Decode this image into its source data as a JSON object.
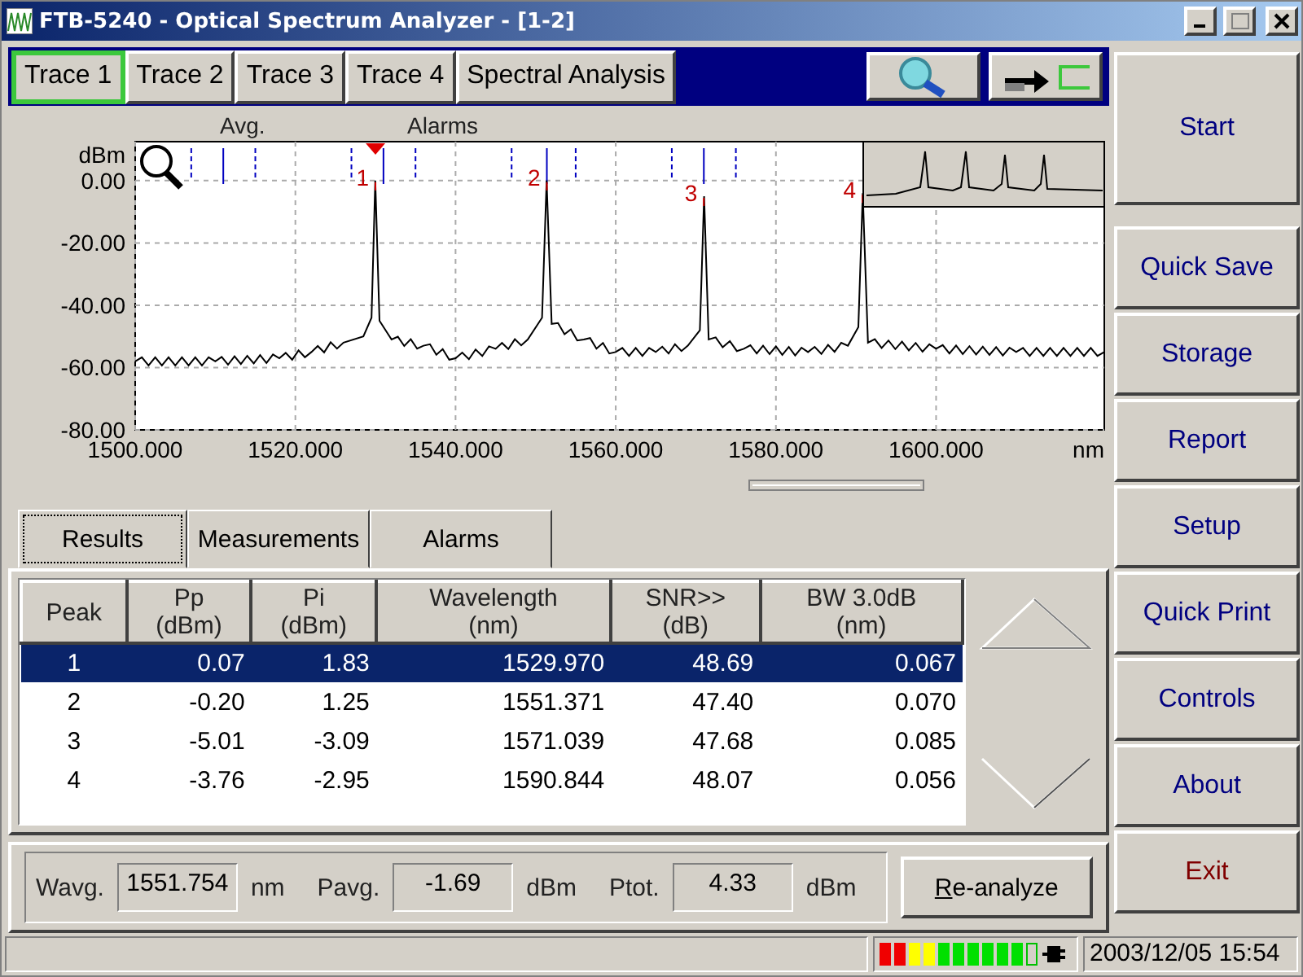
{
  "window": {
    "title": "FTB-5240 - Optical Spectrum Analyzer - [1-2]"
  },
  "trace_tabs": [
    {
      "label": "Trace 1",
      "selected": true
    },
    {
      "label": "Trace 2",
      "selected": false
    },
    {
      "label": "Trace 3",
      "selected": false
    },
    {
      "label": "Trace 4",
      "selected": false
    },
    {
      "label": "Spectral Analysis",
      "selected": false
    }
  ],
  "chart_header": {
    "left": "Avg.",
    "right": "Alarms"
  },
  "chart_data": {
    "type": "line",
    "xlabel": "nm",
    "ylabel": "dBm",
    "x": [
      1500,
      1510,
      1518,
      1522,
      1526,
      1528.5,
      1529.5,
      1529.97,
      1530.5,
      1532,
      1536,
      1540,
      1545,
      1549,
      1550.8,
      1551.371,
      1552,
      1556,
      1560,
      1565,
      1569,
      1570.5,
      1571.039,
      1571.6,
      1576,
      1584,
      1589,
      1590.3,
      1590.844,
      1591.5,
      1600,
      1610,
      1621
    ],
    "series": [
      {
        "color": "#000000",
        "values": [
          -58,
          -58,
          -57,
          -55,
          -52,
          -50,
          -44,
          0,
          -45,
          -51,
          -53,
          -57,
          -54,
          -51,
          -44,
          0,
          -46,
          -51,
          -55,
          -55,
          -53,
          -48,
          -5,
          -51,
          -54,
          -55,
          -53,
          -47,
          -4,
          -52,
          -54,
          -55,
          -55
        ]
      }
    ],
    "grid": true,
    "ref_lines": [
      {
        "axis": "x",
        "value": 1507
      },
      {
        "axis": "x",
        "value": 1511
      },
      {
        "axis": "x",
        "value": 1515
      },
      {
        "axis": "x",
        "value": 1527
      },
      {
        "axis": "x",
        "value": 1531
      },
      {
        "axis": "x",
        "value": 1535
      },
      {
        "axis": "x",
        "value": 1547
      },
      {
        "axis": "x",
        "value": 1551.4
      },
      {
        "axis": "x",
        "value": 1555
      },
      {
        "axis": "x",
        "value": 1567
      },
      {
        "axis": "x",
        "value": 1571
      },
      {
        "axis": "x",
        "value": 1575
      }
    ],
    "xlim": [
      1500,
      1621
    ],
    "ylim": [
      -80,
      12.5
    ],
    "xticks": [
      {
        "value": 1500,
        "label": "1500.000"
      },
      {
        "value": 1520,
        "label": "1520.000"
      },
      {
        "value": 1540,
        "label": "1540.000"
      },
      {
        "value": 1560,
        "label": "1560.000"
      },
      {
        "value": 1580,
        "label": "1580.000"
      },
      {
        "value": 1600,
        "label": "1600.000"
      }
    ],
    "yticks": [
      {
        "value": 0,
        "label": "0.00"
      },
      {
        "value": -20,
        "label": "-20.00"
      },
      {
        "value": -40,
        "label": "-40.00"
      },
      {
        "value": -60,
        "label": "-60.00"
      },
      {
        "value": -80,
        "label": "-80.00"
      }
    ],
    "annotations": [
      {
        "x": 1530,
        "y": 0,
        "text": "1"
      },
      {
        "x": 1551.4,
        "y": 0,
        "text": "2"
      },
      {
        "x": 1571,
        "y": -5,
        "text": "3"
      },
      {
        "x": 1590.8,
        "y": -4,
        "text": "4"
      }
    ]
  },
  "result_tabs": [
    {
      "label": "Results",
      "selected": true
    },
    {
      "label": "Measurements",
      "selected": false
    },
    {
      "label": "Alarms",
      "selected": false
    }
  ],
  "table": {
    "columns": [
      {
        "label": "Peak"
      },
      {
        "label": "Pp",
        "unit": "(dBm)"
      },
      {
        "label": "Pi",
        "unit": "(dBm)"
      },
      {
        "label": "Wavelength",
        "unit": "(nm)"
      },
      {
        "label": "SNR>>",
        "unit": "(dB)"
      },
      {
        "label": "BW 3.0dB",
        "unit": "(nm)"
      }
    ],
    "rows": [
      {
        "selected": true,
        "cells": [
          "1",
          "0.07",
          "1.83",
          "1529.970",
          "48.69",
          "0.067"
        ]
      },
      {
        "selected": false,
        "cells": [
          "2",
          "-0.20",
          "1.25",
          "1551.371",
          "47.40",
          "0.070"
        ]
      },
      {
        "selected": false,
        "cells": [
          "3",
          "-5.01",
          "-3.09",
          "1571.039",
          "47.68",
          "0.085"
        ]
      },
      {
        "selected": false,
        "cells": [
          "4",
          "-3.76",
          "-2.95",
          "1590.844",
          "48.07",
          "0.056"
        ]
      }
    ]
  },
  "summary": [
    {
      "label": "Wavg.",
      "value": "1551.754",
      "unit": "nm"
    },
    {
      "label": "Pavg.",
      "value": "-1.69",
      "unit": "dBm"
    },
    {
      "label": "Ptot.",
      "value": "4.33",
      "unit": "dBm"
    }
  ],
  "reanalyze_button": "Re-analyze",
  "side_buttons": [
    {
      "label": "Start",
      "color": "#000080"
    },
    {
      "label": "Quick Save",
      "color": "#000080"
    },
    {
      "label": "Storage",
      "color": "#000080"
    },
    {
      "label": "Report",
      "color": "#000080"
    },
    {
      "label": "Setup",
      "color": "#000080"
    },
    {
      "label": "Quick Print",
      "color": "#000080"
    },
    {
      "label": "Controls",
      "color": "#000080"
    },
    {
      "label": "About",
      "color": "#000080"
    },
    {
      "label": "Exit",
      "color": "#800000"
    }
  ],
  "status_bar": {
    "datetime": "2003/12/05 15:54"
  }
}
